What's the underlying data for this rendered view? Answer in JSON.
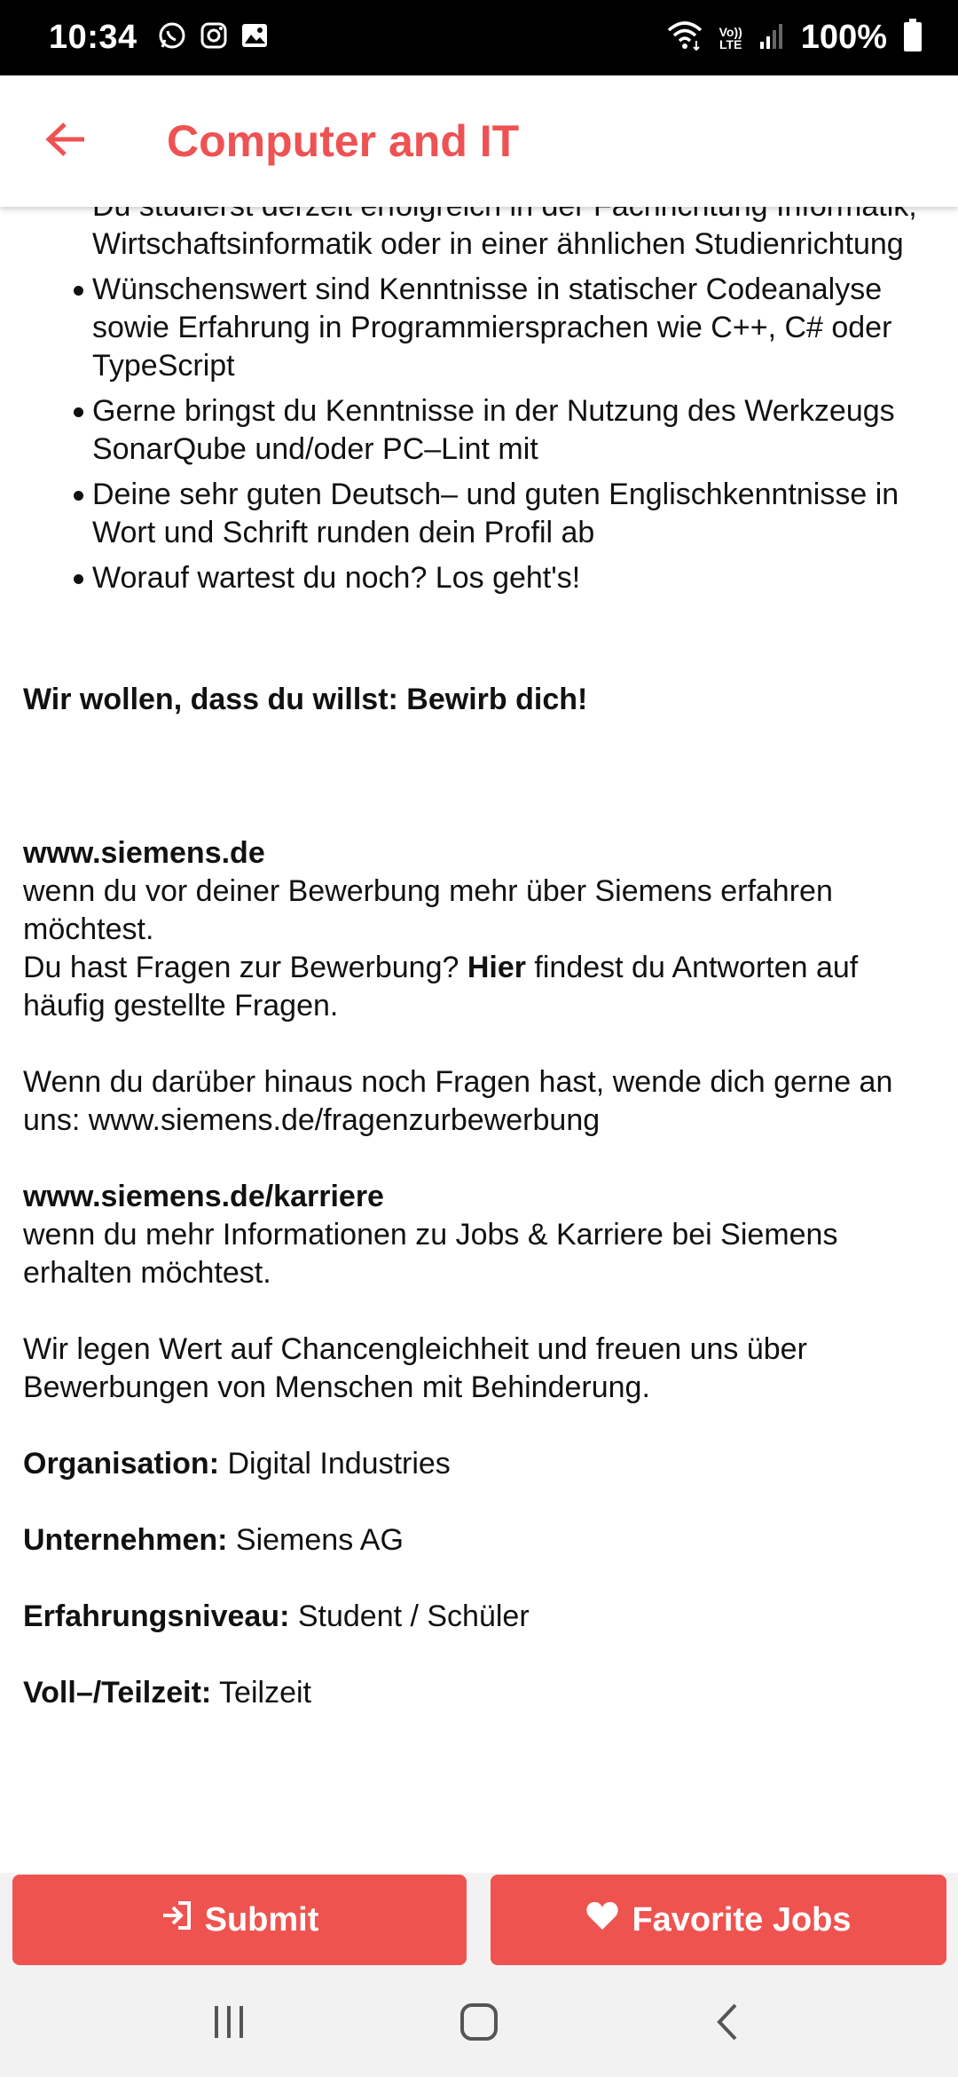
{
  "status_bar": {
    "time": "10:34",
    "battery": "100%",
    "lte_top": "Vo))",
    "lte_bottom": "LTE",
    "icons": [
      "whatsapp-icon",
      "instagram-icon",
      "gallery-icon",
      "wifi-icon",
      "signal-icon",
      "battery-icon"
    ]
  },
  "app_bar": {
    "title": "Computer and IT",
    "back_icon": "arrow-left-icon"
  },
  "content": {
    "bullets": [
      "Du studierst derzeit erfolgreich in der Fachrichtung Informatik, Wirtschaftsinformatik oder in einer ähnlichen Studienrichtung",
      "Wünschenswert sind Kenntnisse in statischer Codeanalyse sowie Erfahrung in Programmiersprachen wie C++, C# oder TypeScript",
      "Gerne bringst du Kenntnisse in der Nutzung des Werkzeugs SonarQube und/oder PC–Lint mit",
      "Deine sehr guten Deutsch– und guten Englischkenntnisse in Wort und Schrift runden dein Profil ab",
      "Worauf wartest du noch? Los geht's!"
    ],
    "apply_heading": "Wir wollen, dass du willst: Bewirb dich!",
    "site_link": "www.siemens.de",
    "site_text": "wenn du vor deiner Bewerbung mehr über Siemens erfahren möchtest.",
    "faq_prefix": "Du hast Fragen zur Bewerbung? ",
    "faq_link": "Hier",
    "faq_suffix": " findest du Antworten auf häufig gestellte Fragen.",
    "contact_text": "Wenn du darüber hinaus noch Fragen hast, wende dich gerne an uns: www.siemens.de/fragenzurbewerbung",
    "career_link": "www.siemens.de/karriere",
    "career_text": "wenn du mehr Informationen zu Jobs & Karriere bei Siemens erhalten möchtest.",
    "equality_text": "Wir legen Wert auf Chancengleichheit und freuen uns über Bewerbungen von Menschen mit Behinderung.",
    "fields": [
      {
        "label": "Organisation:",
        "value": " Digital Industries"
      },
      {
        "label": "Unternehmen:",
        "value": " Siemens AG"
      },
      {
        "label": "Erfahrungsniveau:",
        "value": " Student / Schüler"
      },
      {
        "label": "Voll–/Teilzeit:",
        "value": " Teilzeit"
      }
    ]
  },
  "buttons": {
    "submit_label": "Submit",
    "submit_icon": "login-icon",
    "favorite_label": "Favorite Jobs",
    "favorite_icon": "heart-icon"
  },
  "nav_bar": {
    "icons": [
      "recent-apps-icon",
      "home-icon",
      "back-icon"
    ]
  },
  "colors": {
    "accent": "#ef5350",
    "status_bar": "#000000",
    "nav_bar": "#f2f2f2"
  }
}
